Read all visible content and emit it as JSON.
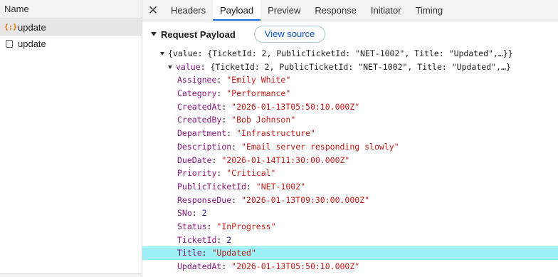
{
  "left_panel": {
    "header": "Name",
    "requests": [
      {
        "icon": "xhr-braces-icon",
        "name": "update",
        "selected": true
      },
      {
        "icon": "document-icon",
        "name": "update",
        "selected": false
      }
    ]
  },
  "tabs": {
    "close_glyph": "✕",
    "items": [
      "Headers",
      "Payload",
      "Preview",
      "Response",
      "Initiator",
      "Timing"
    ],
    "active": "Payload"
  },
  "payload": {
    "section_title": "Request Payload",
    "view_source_label": "View source",
    "root_summary": "{value: {TicketId: 2, PublicTicketId: \"NET-1002\", Title: \"Updated\",…}}",
    "value_key": "value",
    "value_summary": "{TicketId: 2, PublicTicketId: \"NET-1002\", Title: \"Updated\",…}",
    "fields": [
      {
        "key": "Assignee",
        "value": "\"Emily White\"",
        "kind": "string"
      },
      {
        "key": "Category",
        "value": "\"Performance\"",
        "kind": "string"
      },
      {
        "key": "CreatedAt",
        "value": "\"2026-01-13T05:50:10.000Z\"",
        "kind": "string"
      },
      {
        "key": "CreatedBy",
        "value": "\"Bob Johnson\"",
        "kind": "string"
      },
      {
        "key": "Department",
        "value": "\"Infrastructure\"",
        "kind": "string"
      },
      {
        "key": "Description",
        "value": "\"Email server responding slowly\"",
        "kind": "string"
      },
      {
        "key": "DueDate",
        "value": "\"2026-01-14T11:30:00.000Z\"",
        "kind": "string"
      },
      {
        "key": "Priority",
        "value": "\"Critical\"",
        "kind": "string"
      },
      {
        "key": "PublicTicketId",
        "value": "\"NET-1002\"",
        "kind": "string"
      },
      {
        "key": "ResponseDue",
        "value": "\"2026-01-13T09:30:00.000Z\"",
        "kind": "string"
      },
      {
        "key": "SNo",
        "value": "2",
        "kind": "number"
      },
      {
        "key": "Status",
        "value": "\"InProgress\"",
        "kind": "string"
      },
      {
        "key": "TicketId",
        "value": "2",
        "kind": "number"
      },
      {
        "key": "Title",
        "value": "\"Updated\"",
        "kind": "string",
        "highlighted": true
      },
      {
        "key": "UpdatedAt",
        "value": "\"2026-01-13T05:50:10.000Z\"",
        "kind": "string"
      }
    ]
  },
  "colors": {
    "key": "#881280",
    "string": "#c41a16",
    "number": "#1a1aa6",
    "highlight": "#9ef0f7",
    "tab_active_underline": "#1a73e8",
    "xhr_icon": "#e37400"
  }
}
